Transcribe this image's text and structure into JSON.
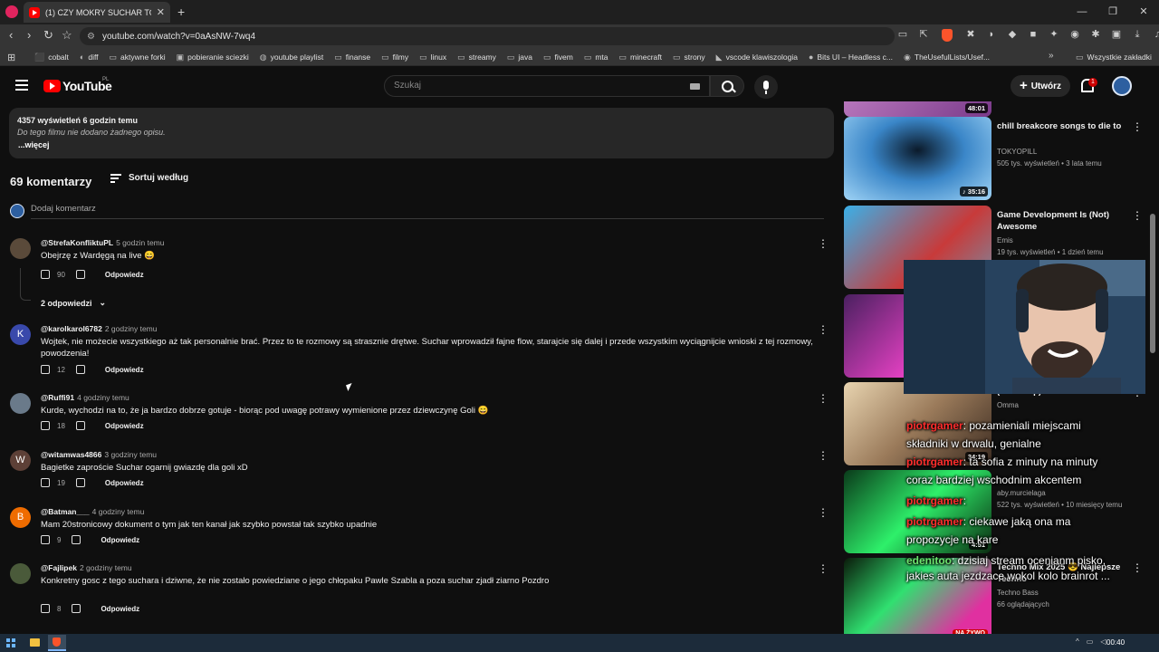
{
  "browser": {
    "tab_title": "(1) CZY MOKRY SUCHAR TO ZA...",
    "url": "youtube.com/watch?v=0aAsNW-7wq4",
    "window_controls": [
      "—",
      "❐",
      "✕"
    ],
    "bookmarks": [
      {
        "label": "cobalt",
        "icon": "cobalt-icon"
      },
      {
        "label": "diff",
        "icon": "diff-icon"
      },
      {
        "label": "aktywne forki",
        "icon": "folder-icon"
      },
      {
        "label": "pobieranie sciezki",
        "icon": "page-icon"
      },
      {
        "label": "youtube playlist",
        "icon": "globe-icon"
      },
      {
        "label": "finanse",
        "icon": "folder-icon"
      },
      {
        "label": "filmy",
        "icon": "folder-icon"
      },
      {
        "label": "linux",
        "icon": "folder-icon"
      },
      {
        "label": "streamy",
        "icon": "folder-icon"
      },
      {
        "label": "java",
        "icon": "folder-icon"
      },
      {
        "label": "fivem",
        "icon": "folder-icon"
      },
      {
        "label": "mta",
        "icon": "folder-icon"
      },
      {
        "label": "minecraft",
        "icon": "folder-icon"
      },
      {
        "label": "strony",
        "icon": "folder-icon"
      },
      {
        "label": "vscode klawiszologia",
        "icon": "vscode-icon"
      },
      {
        "label": "Bits UI – Headless c...",
        "icon": "circle-icon"
      },
      {
        "label": "TheUsefulLists/Usef...",
        "icon": "github-icon"
      }
    ],
    "bookmarks_more": "»",
    "all_bookmarks": "Wszystkie zakładki"
  },
  "youtube": {
    "wordmark": "YouTube",
    "region": "PL",
    "search_placeholder": "Szukaj",
    "create_label": "Utwórz",
    "notification_count": "1"
  },
  "description": {
    "stats": "4357 wyświetleń  6 godzin temu",
    "text": "Do tego filmu nie dodano żadnego opisu.",
    "more": "...więcej"
  },
  "comments_header": {
    "count": "69 komentarzy",
    "sort": "Sortuj według",
    "add_placeholder": "Dodaj komentarz"
  },
  "comments": [
    {
      "author": "@StrefaKonfliktuPL",
      "time": "5 godzin temu",
      "text": "Obejrzę z Wardęgą na live 😄",
      "likes": "90",
      "reply": "Odpowiedz",
      "avatar_color": "#5a4a3a",
      "avatar_letter": ""
    },
    {
      "author": "@karolkarol6782",
      "time": "2 godziny temu",
      "text": "Wojtek, nie możecie wszystkiego aż tak personalnie brać. Przez to te rozmowy są strasznie drętwe. Suchar wprowadził fajne flow, starajcie się dalej i przede wszystkim wyciągnijcie wnioski z tej rozmowy, powodzenia!",
      "likes": "12",
      "reply": "Odpowiedz",
      "avatar_color": "#3949ab",
      "avatar_letter": "K"
    },
    {
      "author": "@Ruffi91",
      "time": "4 godziny temu",
      "text": "Kurde, wychodzi na to, że ja bardzo dobrze gotuje - biorąc pod uwagę potrawy wymienione przez dziewczynę Goli 😄",
      "likes": "18",
      "reply": "Odpowiedz",
      "avatar_color": "#6a7a8a",
      "avatar_letter": ""
    },
    {
      "author": "@witamwas4866",
      "time": "3 godziny temu",
      "text": "Bagietke zaproście Suchar ogarnij gwiazdę dla goli xD",
      "likes": "19",
      "reply": "Odpowiedz",
      "avatar_color": "#5d4037",
      "avatar_letter": "W"
    },
    {
      "author": "@Batman___",
      "time": "4 godziny temu",
      "text": "Mam 20stronicowy dokument o tym jak ten kanał jak szybko powstał tak szybko upadnie",
      "likes": "9",
      "reply": "Odpowiedz",
      "avatar_color": "#ef6c00",
      "avatar_letter": "B"
    },
    {
      "author": "@Fajlipek",
      "time": "2 godziny temu",
      "text": "Konkretny gosc z tego suchara i dziwne, że nie zostało powiedziane o jego chłopaku Pawle Szabla a poza suchar zjadł ziarno Pozdro",
      "likes": "8",
      "reply": "Odpowiedz",
      "avatar_color": "#4a5a3a",
      "avatar_letter": ""
    }
  ],
  "replies_toggle": "2 odpowiedzi",
  "sidebar": [
    {
      "title": "",
      "channel": "",
      "meta": "",
      "duration": "48:01",
      "thumb": "linear-gradient(135deg,#d08fd0,#7a3a8a)"
    },
    {
      "title": "chill breakcore songs to die to",
      "channel": "TOKYOPILL",
      "meta": "505 tys. wyświetleń • 3 lata temu",
      "duration": "♪ 35:16",
      "thumb": "radial-gradient(ellipse at 50% 40%,#0b1a2a 0%,#3a86c8 45%,#9fd3f5 100%)"
    },
    {
      "title": "Game Development Is (Not) Awesome",
      "channel": "Emis",
      "meta": "19 tys. wyświetleń • 1 dzień temu",
      "duration": "",
      "thumb": "linear-gradient(135deg,#3ab0e8,#c83a3a 60%,#7a8aa0)"
    },
    {
      "title": "",
      "channel": "",
      "meta": "",
      "duration": "",
      "thumb": "linear-gradient(135deg,#4a2060,#e040c0 60%,#2a1030)"
    },
    {
      "title": "(ft. Schlep)",
      "channel": "Omma",
      "meta": "",
      "duration": "34:19",
      "thumb": "linear-gradient(135deg,#e8d4b0,#9a7a5a 50%,#3a2a20)"
    },
    {
      "title": "",
      "channel": "aby.murcielaga",
      "meta": "522 tys. wyświetleń • 10 miesięcy temu",
      "duration": "4:51",
      "thumb": "linear-gradient(135deg,#0a3a1a,#2ef06a 50%,#0a2a10)"
    },
    {
      "title": "Techno Mix 2025 😎 Najlepsze Techno",
      "channel": "Techno Bass",
      "meta": "66 oglądających",
      "duration": "",
      "live": "NA ŻYWO",
      "thumb": "linear-gradient(135deg,#0a1a0a,#30e070 40%,#e030a0 80%)"
    }
  ],
  "chat": [
    {
      "user": "piotrgamer",
      "text": ": pozamieniali miejscami"
    },
    {
      "user": "",
      "text": "składniki w drwalu, genialne"
    },
    {
      "user": "piotrgamer",
      "text": ": ta sofia z minuty na minuty"
    },
    {
      "user": "",
      "text": "coraz bardziej wschodnim akcentem"
    },
    {
      "user": "piotrgamer",
      "text": ":"
    },
    {
      "user": "piotrgamer",
      "text": ": ciekawe jaką ona ma"
    },
    {
      "user": "",
      "text": "propozycje na kare"
    },
    {
      "user": "edenitoo",
      "text": ": dzisiaj stream ocenianm pisko,"
    },
    {
      "user": "",
      "text": "jakies auta jezdzace wokol kolo brainrot ..."
    }
  ],
  "taskbar": {
    "clock": "00:40",
    "tray": "^"
  }
}
